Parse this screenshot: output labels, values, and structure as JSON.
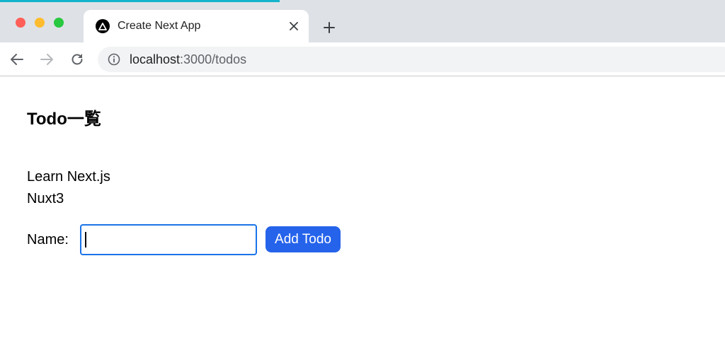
{
  "colors": {
    "tabstrip_bg": "#dee1e6",
    "top_accent": "#12b5cb",
    "traffic_red": "#ff5f57",
    "traffic_yellow": "#febc2e",
    "traffic_green": "#28c840",
    "primary_button": "#2563eb",
    "input_focus": "#1a73e8"
  },
  "browser": {
    "tab": {
      "title": "Create Next App",
      "favicon": "nextjs-triangle-icon",
      "close_icon": "close-icon"
    },
    "new_tab_icon": "plus-icon",
    "nav": {
      "back_icon": "arrow-left-icon",
      "forward_icon": "arrow-right-icon",
      "reload_icon": "reload-icon"
    },
    "address_bar": {
      "info_icon": "info-icon",
      "host": "localhost",
      "path": ":3000/todos"
    }
  },
  "page": {
    "title": "Todo一覧",
    "todos": [
      {
        "label": "Learn Next.js"
      },
      {
        "label": "Nuxt3"
      }
    ],
    "form": {
      "name_label": "Name:",
      "name_value": "",
      "submit_label": "Add Todo"
    }
  }
}
